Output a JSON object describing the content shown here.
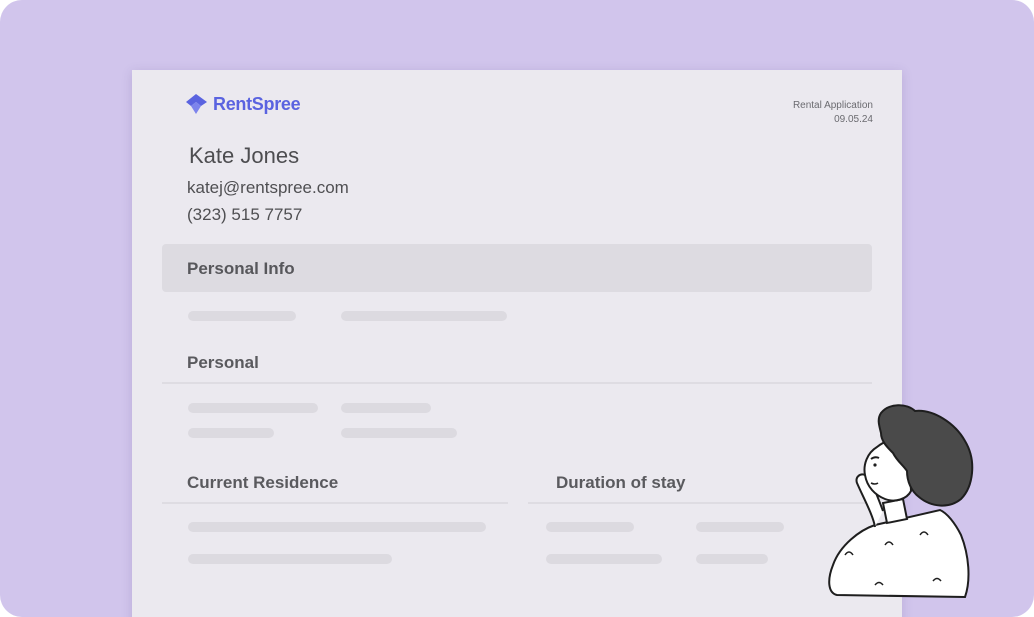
{
  "brand": {
    "name": "RentSpree",
    "color": "#5a63e0"
  },
  "document": {
    "type_label": "Rental Application",
    "date": "09.05.24"
  },
  "applicant": {
    "name": "Kate Jones",
    "email": "katej@rentspree.com",
    "phone": "(323) 515 7757"
  },
  "sections": {
    "personal_info": "Personal Info",
    "personal": "Personal",
    "current_residence": "Current Residence",
    "duration_of_stay": "Duration of stay"
  },
  "colors": {
    "background": "#d1c5ec",
    "sheet": "#ebe9ef",
    "section_bar": "#dddbe1"
  },
  "illustration": {
    "subject": "thinking-woman-illustration"
  }
}
